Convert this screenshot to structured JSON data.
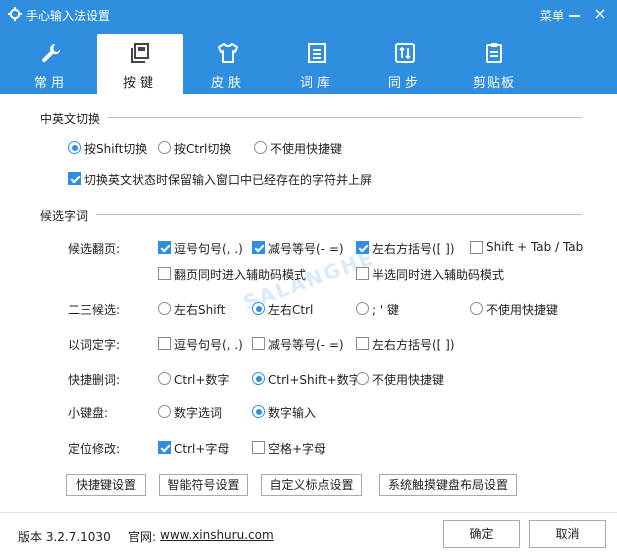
{
  "window": {
    "title": "手心输入法设置",
    "menu_label": "菜单"
  },
  "tabs": [
    {
      "label": "常用",
      "icon": "wrench-icon"
    },
    {
      "label": "按键",
      "icon": "keyboard-icon"
    },
    {
      "label": "皮肤",
      "icon": "shirt-icon"
    },
    {
      "label": "词库",
      "icon": "document-icon"
    },
    {
      "label": "同步",
      "icon": "sync-icon"
    },
    {
      "label": "剪贴板",
      "icon": "clipboard-icon"
    }
  ],
  "active_tab": "按键",
  "section_switch": {
    "title": "中英文切换",
    "options": [
      "按Shift切换",
      "按Ctrl切换",
      "不使用快捷键"
    ],
    "selected": "按Shift切换",
    "keep_text_label": "切换英文状态时保留输入窗口中已经存在的字符并上屏",
    "keep_text_checked": true
  },
  "section_candidate": {
    "title": "候选字词",
    "page_turn": {
      "label": "候选翻页:",
      "options": [
        {
          "label": "逗号句号(, .)",
          "checked": true
        },
        {
          "label": "减号等号(- =)",
          "checked": true
        },
        {
          "label": "左右方括号([ ])",
          "checked": true
        },
        {
          "label": "Shift + Tab / Tab",
          "checked": false
        },
        {
          "label": "翻页同时进入辅助码模式",
          "checked": false
        },
        {
          "label": "半选同时进入辅助码模式",
          "checked": false
        }
      ]
    },
    "second_candidate": {
      "label": "二三候选:",
      "options": [
        "左右Shift",
        "左右Ctrl",
        "; '  键",
        "不使用快捷键"
      ],
      "selected": "左右Ctrl"
    },
    "word_select": {
      "label": "以词定字:",
      "options": [
        {
          "label": "逗号句号(, .)",
          "checked": false
        },
        {
          "label": "减号等号(- =)",
          "checked": false
        },
        {
          "label": "左右方括号([ ])",
          "checked": false
        }
      ]
    },
    "delete_word": {
      "label": "快捷删词:",
      "options": [
        "Ctrl+数字",
        "Ctrl+Shift+数字",
        "不使用快捷键"
      ],
      "selected": "Ctrl+Shift+数字"
    },
    "keypad": {
      "label": "小键盘:",
      "options": [
        "数字选词",
        "数字输入"
      ],
      "selected": "数字输入"
    },
    "position_edit": {
      "label": "定位修改:",
      "options": [
        {
          "label": "Ctrl+字母",
          "checked": true
        },
        {
          "label": "空格+字母",
          "checked": false
        }
      ]
    }
  },
  "action_buttons": [
    "快捷键设置",
    "智能符号设置",
    "自定义标点设置",
    "系统触摸键盘布局设置"
  ],
  "footer": {
    "version": "版本 3.2.7.1030",
    "site_label": "官网:",
    "site_url": "www.xinshuru.com",
    "ok_label": "确定",
    "cancel_label": "取消"
  },
  "colors": {
    "accent": "#2f8ee0"
  }
}
